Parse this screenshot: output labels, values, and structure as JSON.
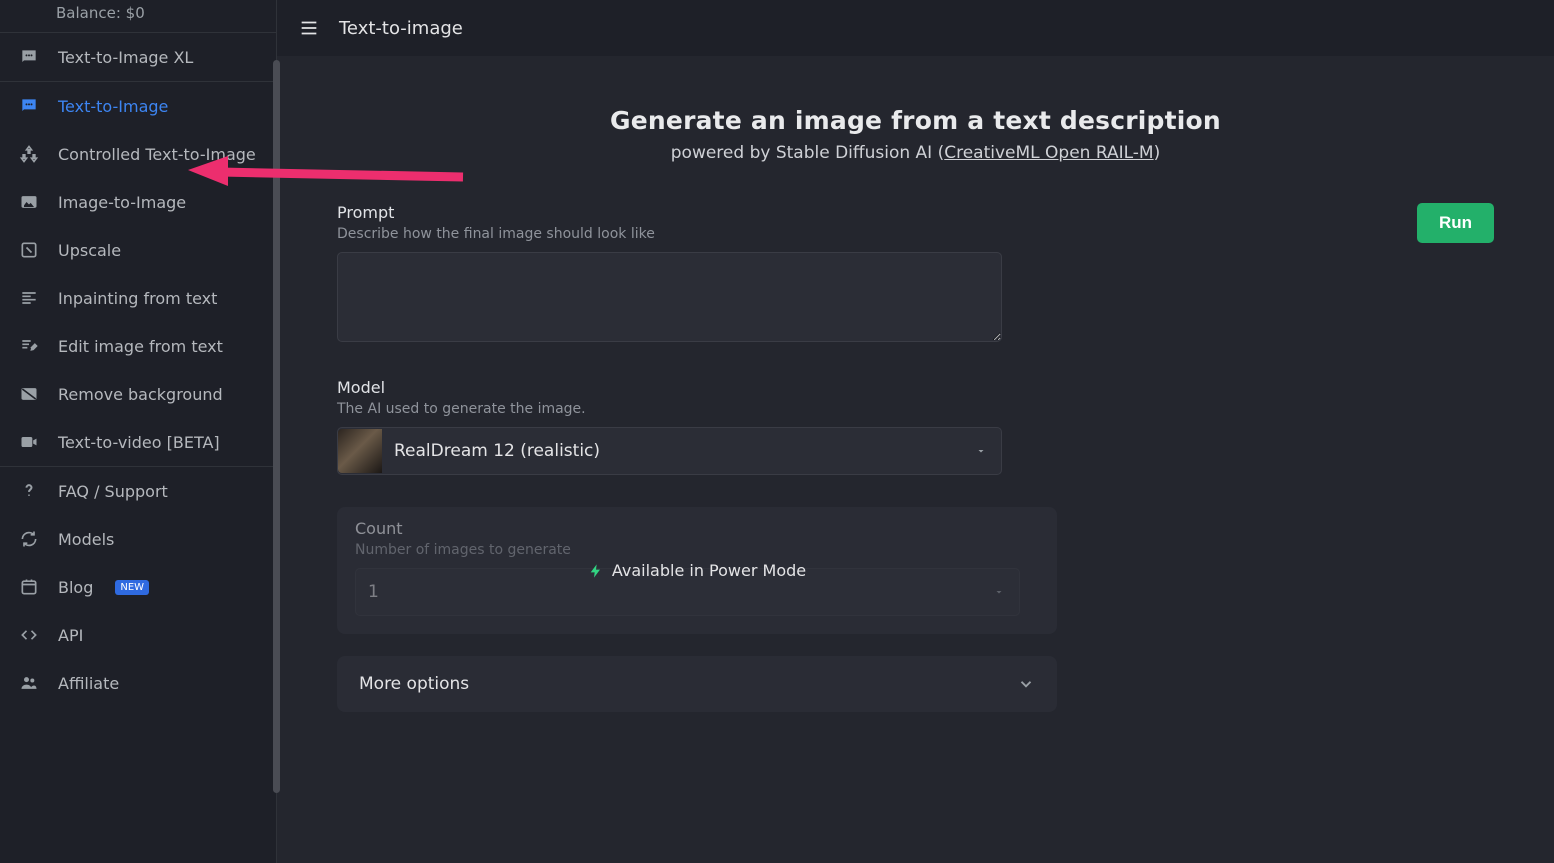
{
  "sidebar": {
    "balance_label": "Balance: $0",
    "items": [
      {
        "label": "Text-to-Image XL",
        "icon": "chat-icon",
        "active": false
      },
      {
        "label": "Text-to-Image",
        "icon": "chat-icon",
        "active": true
      },
      {
        "label": "Controlled Text-to-Image",
        "icon": "sliders-icon",
        "active": false
      },
      {
        "label": "Image-to-Image",
        "icon": "image-icon",
        "active": false
      },
      {
        "label": "Upscale",
        "icon": "expand-icon",
        "active": false
      },
      {
        "label": "Inpainting from text",
        "icon": "lines-icon",
        "active": false
      },
      {
        "label": "Edit image from text",
        "icon": "edit-icon",
        "active": false
      },
      {
        "label": "Remove background",
        "icon": "remove-bg-icon",
        "active": false
      },
      {
        "label": "Text-to-video [BETA]",
        "icon": "video-icon",
        "active": false
      }
    ],
    "footer_items": [
      {
        "label": "FAQ / Support",
        "icon": "question-icon",
        "badge": null
      },
      {
        "label": "Models",
        "icon": "refresh-icon",
        "badge": null
      },
      {
        "label": "Blog",
        "icon": "calendar-icon",
        "badge": "NEW"
      },
      {
        "label": "API",
        "icon": "code-icon",
        "badge": null
      },
      {
        "label": "Affiliate",
        "icon": "people-icon",
        "badge": null
      }
    ]
  },
  "topbar": {
    "title": "Text-to-image"
  },
  "heading": {
    "title": "Generate an image from a text description",
    "sub_prefix": "powered by Stable Diffusion AI (",
    "sub_link": "CreativeML Open RAIL-M",
    "sub_suffix": ")"
  },
  "run_button": "Run",
  "form": {
    "prompt": {
      "label": "Prompt",
      "sub": "Describe how the final image should look like",
      "value": ""
    },
    "model": {
      "label": "Model",
      "sub": "The AI used to generate the image.",
      "selected": "RealDream 12 (realistic)"
    },
    "count": {
      "label": "Count",
      "sub": "Number of images to generate",
      "selected": "1",
      "overlay_text": "Available in Power Mode"
    },
    "more_options_label": "More options"
  }
}
